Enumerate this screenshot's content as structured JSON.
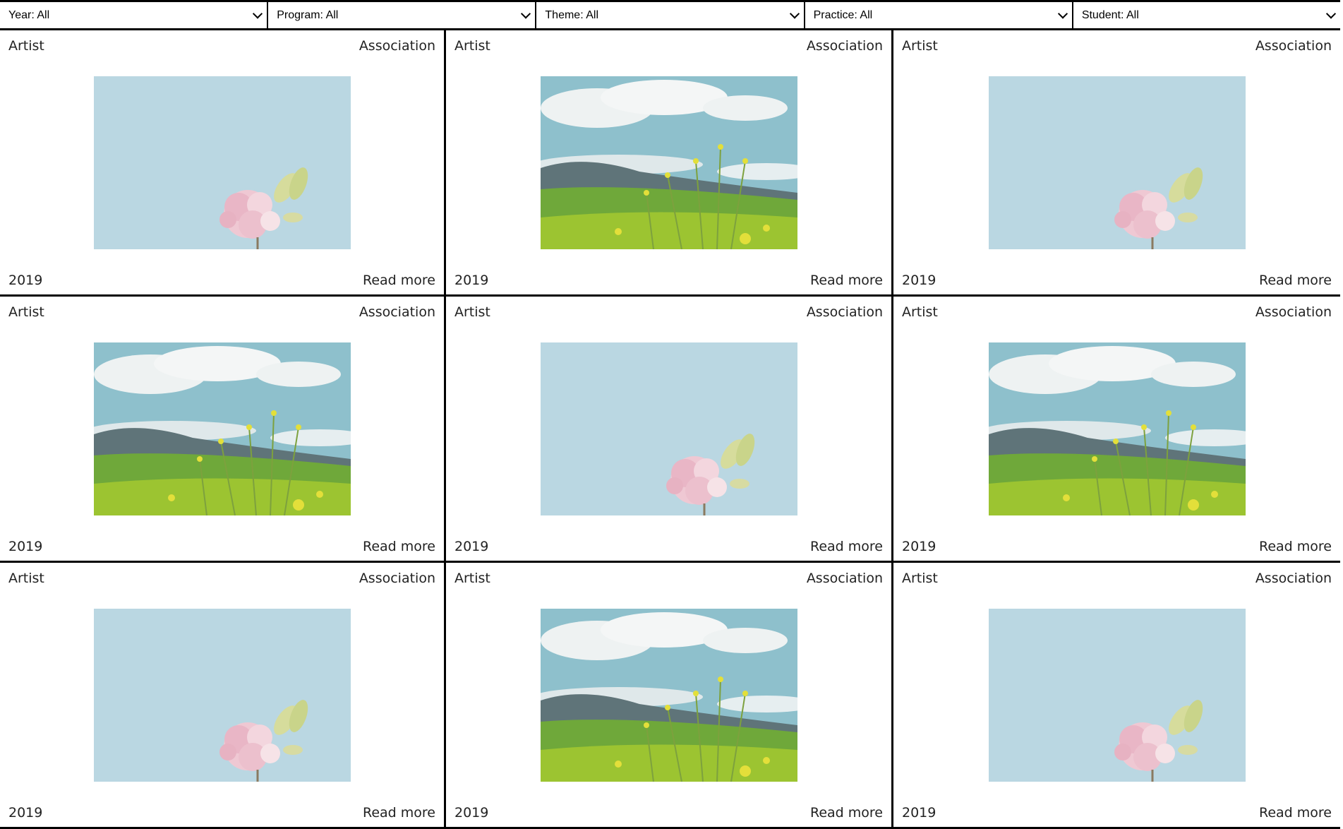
{
  "filters": [
    {
      "label": "Year: All"
    },
    {
      "label": "Program: All"
    },
    {
      "label": "Theme: All"
    },
    {
      "label": "Practice: All"
    },
    {
      "label": "Student: All"
    }
  ],
  "cards": [
    {
      "category": "Artist",
      "type": "Association",
      "year": "2019",
      "link": "Read more",
      "image": "flower"
    },
    {
      "category": "Artist",
      "type": "Association",
      "year": "2019",
      "link": "Read more",
      "image": "field"
    },
    {
      "category": "Artist",
      "type": "Association",
      "year": "2019",
      "link": "Read more",
      "image": "flower"
    },
    {
      "category": "Artist",
      "type": "Association",
      "year": "2019",
      "link": "Read more",
      "image": "field"
    },
    {
      "category": "Artist",
      "type": "Association",
      "year": "2019",
      "link": "Read more",
      "image": "flower"
    },
    {
      "category": "Artist",
      "type": "Association",
      "year": "2019",
      "link": "Read more",
      "image": "field"
    },
    {
      "category": "Artist",
      "type": "Association",
      "year": "2019",
      "link": "Read more",
      "image": "flower"
    },
    {
      "category": "Artist",
      "type": "Association",
      "year": "2019",
      "link": "Read more",
      "image": "field"
    },
    {
      "category": "Artist",
      "type": "Association",
      "year": "2019",
      "link": "Read more",
      "image": "flower"
    }
  ]
}
